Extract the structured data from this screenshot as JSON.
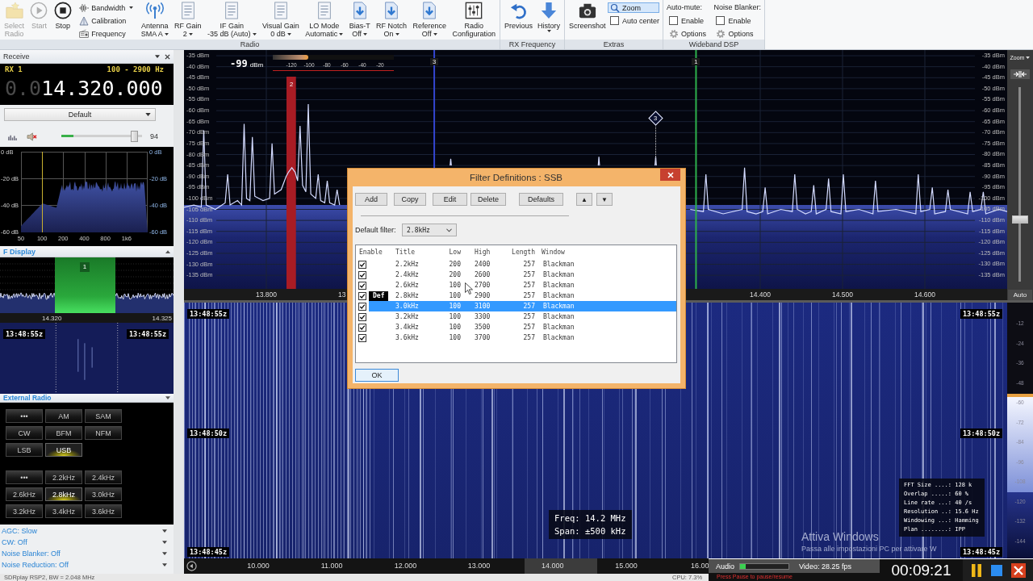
{
  "ribbon": {
    "groups": [
      {
        "label": "Radio",
        "items": [
          {
            "kind": "large",
            "lines": [
              "Select",
              "Radio"
            ],
            "dropdown": false,
            "disabled": true
          },
          {
            "kind": "large",
            "lines": [
              "Start"
            ],
            "dropdown": false,
            "disabled": true
          },
          {
            "kind": "large",
            "lines": [
              "Stop"
            ],
            "dropdown": false,
            "disabled": false
          },
          {
            "kind": "stack",
            "items": [
              {
                "kind": "tool",
                "label": "Bandwidth",
                "dropdown": true
              },
              {
                "kind": "tool",
                "label": "Calibration",
                "dropdown": false
              },
              {
                "kind": "tool",
                "label": "Frequency",
                "dropdown": false
              }
            ]
          },
          {
            "kind": "large",
            "lines": [
              "Antenna",
              "SMA A"
            ],
            "dropdown": true,
            "disabled": false
          },
          {
            "kind": "large",
            "lines": [
              "RF Gain",
              "2"
            ],
            "dropdown": true,
            "disabled": false
          },
          {
            "kind": "large",
            "lines": [
              "IF Gain",
              "-35 dB (Auto)"
            ],
            "dropdown": true,
            "disabled": false
          },
          {
            "kind": "large",
            "lines": [
              "Visual Gain",
              "0 dB"
            ],
            "dropdown": true,
            "disabled": false
          },
          {
            "kind": "large",
            "lines": [
              "LO Mode",
              "Automatic"
            ],
            "dropdown": true,
            "disabled": false
          },
          {
            "kind": "large",
            "lines": [
              "Bias-T",
              "Off"
            ],
            "dropdown": true,
            "disabled": false
          },
          {
            "kind": "large",
            "lines": [
              "RF Notch",
              "On"
            ],
            "dropdown": true,
            "disabled": false
          },
          {
            "kind": "large",
            "lines": [
              "Reference",
              "Off"
            ],
            "dropdown": true,
            "disabled": false
          },
          {
            "kind": "large",
            "lines": [
              "Radio",
              "Configuration"
            ],
            "dropdown": false,
            "disabled": false
          }
        ]
      },
      {
        "label": "RX Frequency",
        "items": [
          {
            "kind": "large",
            "lines": [
              "Previous"
            ],
            "dropdown": false,
            "disabled": false
          },
          {
            "kind": "large",
            "lines": [
              "History"
            ],
            "dropdown": true,
            "disabled": false
          }
        ]
      },
      {
        "label": "Extras",
        "items": [
          {
            "kind": "large",
            "lines": [
              "Screenshot"
            ],
            "dropdown": false,
            "disabled": false
          },
          {
            "kind": "stack",
            "items": [
              {
                "kind": "toggle",
                "label": "Zoom",
                "selected": true
              },
              {
                "kind": "check",
                "label": "Auto center",
                "checked": false
              }
            ]
          }
        ]
      },
      {
        "label": "Wideband DSP",
        "items": [
          {
            "kind": "stack",
            "items": [
              {
                "kind": "heading",
                "label": "Auto-mute:"
              },
              {
                "kind": "check",
                "label": "Enable",
                "checked": false
              },
              {
                "kind": "option",
                "label": "Options"
              }
            ]
          },
          {
            "kind": "stack",
            "items": [
              {
                "kind": "heading",
                "label": "Noise Blanker:"
              },
              {
                "kind": "check",
                "label": "Enable",
                "checked": false
              },
              {
                "kind": "option",
                "label": "Options"
              }
            ]
          }
        ]
      }
    ]
  },
  "receive": {
    "title": "Receive",
    "rx": "RX 1",
    "passband": "100 - 2900 Hz",
    "frequency_prefix": "0.0",
    "frequency": "14.320.000",
    "preset": "Default",
    "audio_meter": {
      "level": 0.15
    },
    "volume": {
      "level": 0.94,
      "reading": "94"
    }
  },
  "audio_spectrum": {
    "y_labels": [
      "0 dB",
      "-20 dB",
      "-40 dB",
      "-60 dB"
    ],
    "right_labels": [
      "0 dB",
      "-20 dB",
      "-40 dB",
      "-60 dB"
    ],
    "x_labels": [
      "50",
      "100",
      "200",
      "400",
      "800",
      "1k6"
    ]
  },
  "if_display": {
    "title": "F Display",
    "filter_label": "1",
    "freq_labels": [
      "14.320",
      "14.325"
    ],
    "times": [
      "13:48:55z",
      "13:48:55z"
    ]
  },
  "external_radio": {
    "title": "External Radio",
    "modes": [
      {
        "label": "•••",
        "selected": false
      },
      {
        "label": "AM",
        "selected": false
      },
      {
        "label": "SAM",
        "selected": false
      },
      {
        "label": "CW",
        "selected": false
      },
      {
        "label": "BFM",
        "selected": false
      },
      {
        "label": "NFM",
        "selected": false
      },
      {
        "label": "LSB",
        "selected": false
      },
      {
        "label": "USB",
        "selected": true
      }
    ],
    "filters": [
      {
        "label": "•••",
        "selected": false
      },
      {
        "label": "2.2kHz",
        "selected": false
      },
      {
        "label": "2.4kHz",
        "selected": false
      },
      {
        "label": "2.6kHz",
        "selected": false
      },
      {
        "label": "2.8kHz",
        "selected": true
      },
      {
        "label": "3.0kHz",
        "selected": false
      },
      {
        "label": "3.2kHz",
        "selected": false
      },
      {
        "label": "3.4kHz",
        "selected": false
      },
      {
        "label": "3.6kHz",
        "selected": false
      }
    ]
  },
  "dsp_sections": [
    "AGC: Slow",
    "CW: Off",
    "Noise Blanker: Off",
    "Noise Reduction: Off"
  ],
  "status_bar": {
    "device": "SDRplay RSP2, BW = 2.048 MHz",
    "cpu": "CPU: 7.3%"
  },
  "spectrum": {
    "signal": "-99",
    "signal_unit": "dBm",
    "signal_meter": {
      "level": 0.29
    },
    "meter_labels": [
      "-120",
      "-100",
      "-80",
      "-60",
      "-40",
      "-20"
    ],
    "chart_data": {
      "type": "line",
      "x": [
        13.7,
        13.712,
        13.721,
        13.724,
        13.727,
        13.738,
        13.75,
        13.753,
        13.756,
        13.765,
        13.77,
        13.773,
        13.776,
        13.78,
        13.783,
        13.786,
        13.796,
        13.804,
        13.807,
        13.81,
        13.818,
        13.824,
        13.827,
        13.831,
        13.835,
        13.838,
        13.841,
        13.844,
        13.848,
        13.851,
        13.854,
        13.86,
        13.863,
        13.866,
        13.871,
        13.874,
        13.877,
        13.883,
        13.886,
        13.889,
        13.905,
        13.925,
        13.945,
        13.965,
        13.985,
        14.005,
        14.0232,
        14.024,
        14.0248,
        14.045,
        14.065,
        14.085,
        14.105,
        14.125,
        14.145,
        14.165,
        14.185,
        14.2032,
        14.204,
        14.2048,
        14.225,
        14.245,
        14.2722,
        14.273,
        14.2738,
        14.295,
        14.315,
        14.331,
        14.334,
        14.337,
        14.355,
        14.378,
        14.381,
        14.384,
        14.395,
        14.403,
        14.406,
        14.409,
        14.425,
        14.439,
        14.442,
        14.445,
        14.455,
        14.462,
        14.465,
        14.468,
        14.48,
        14.483,
        14.486,
        14.498,
        14.501,
        14.504,
        14.52,
        14.537,
        14.54,
        14.543,
        14.565,
        14.589,
        14.592,
        14.595,
        14.606,
        14.609,
        14.612,
        14.625,
        14.628,
        14.631,
        14.652,
        14.655,
        14.658,
        14.668,
        14.671,
        14.674,
        14.69,
        14.7
      ],
      "values": [
        -104,
        -103,
        -104,
        -69,
        -103,
        -105,
        -102,
        -89,
        -103,
        -101,
        -103,
        -66,
        -100,
        -101,
        -72,
        -99,
        -101,
        -100,
        -75,
        -98,
        -96,
        -90,
        -88,
        -86,
        -88,
        -92,
        -67,
        -94,
        -97,
        -57,
        -98,
        -100,
        -89,
        -101,
        -102,
        -92,
        -102,
        -103,
        -96,
        -103,
        null,
        null,
        null,
        null,
        null,
        null,
        -85,
        -82,
        -85,
        null,
        null,
        null,
        null,
        null,
        null,
        null,
        null,
        -85,
        -81,
        -85,
        null,
        null,
        -85,
        -81,
        -85,
        null,
        -105,
        -106,
        -89,
        -105,
        -107,
        -105,
        -86,
        -106,
        -107,
        -106,
        -95,
        -107,
        -105,
        -106,
        -89,
        -105,
        -107,
        -106,
        -94,
        -107,
        -105,
        -91,
        -106,
        -107,
        -89,
        -106,
        -105,
        -107,
        -92,
        -106,
        -105,
        -107,
        -89,
        -106,
        -105,
        -95,
        -107,
        -106,
        -96,
        -105,
        -107,
        -97,
        -106,
        -105,
        -97,
        -107,
        -105,
        -106
      ],
      "xlim": [
        13.7,
        14.7
      ],
      "ylim": [
        -141.2,
        -32.4
      ],
      "grid": true,
      "xticks": [
        {
          "value": 13.8,
          "label": "13.800"
        },
        {
          "value": 14.4,
          "label": "14.400"
        },
        {
          "value": 14.5,
          "label": "14.500"
        },
        {
          "value": 14.6,
          "label": "14.600"
        }
      ],
      "yticks": [
        {
          "value": -35,
          "label": "-35 dBm"
        },
        {
          "value": -40,
          "label": "-40 dBm"
        },
        {
          "value": -45,
          "label": "-45 dBm"
        },
        {
          "value": -50,
          "label": "-50 dBm"
        },
        {
          "value": -55,
          "label": "-55 dBm"
        },
        {
          "value": -60,
          "label": "-60 dBm"
        },
        {
          "value": -65,
          "label": "-65 dBm"
        },
        {
          "value": -70,
          "label": "-70 dBm"
        },
        {
          "value": -75,
          "label": "-75 dBm"
        },
        {
          "value": -80,
          "label": "-80 dBm"
        },
        {
          "value": -85,
          "label": "-85 dBm"
        },
        {
          "value": -90,
          "label": "-90 dBm"
        },
        {
          "value": -95,
          "label": "-95 dBm"
        },
        {
          "value": -100,
          "label": "-100 dBm"
        },
        {
          "value": -105,
          "label": "-105 dBm"
        },
        {
          "value": -110,
          "label": "-110 dBm"
        },
        {
          "value": -115,
          "label": "-115 dBm"
        },
        {
          "value": -120,
          "label": "-120 dBm"
        },
        {
          "value": -125,
          "label": "-125 dBm"
        },
        {
          "value": -130,
          "label": "-130 dBm"
        },
        {
          "value": -135,
          "label": "-135 dBm"
        }
      ],
      "bands": [
        {
          "axis": "x",
          "from": 13.8245,
          "to": 13.836,
          "color": "#a81c24"
        }
      ],
      "ref_lines": [
        {
          "axis": "x",
          "value": 14.004,
          "color": "#3346d0"
        },
        {
          "axis": "x",
          "value": 14.322,
          "color": "#2eb04c"
        }
      ]
    },
    "vfo_labels": [
      "2",
      "3",
      "1"
    ],
    "partial_freq_label": "13",
    "db_labels_right": [
      "-35 dBm",
      "-40 dBm",
      "-45 dBm",
      "-50 dBm",
      "-55 dBm",
      "-60 dBm",
      "-65 dBm",
      "-70 dBm",
      "-75 dBm",
      "-80 dBm",
      "-85 dBm",
      "-90 dBm",
      "-95 dBm",
      "-100 dBm",
      "-105 dBm",
      "-110 dBm",
      "-115 dBm",
      "-120 dBm",
      "-125 dBm",
      "-130 dBm",
      "-135 dBm"
    ],
    "marker": "3"
  },
  "waterfall": {
    "times": [
      {
        "left": "13:48:55z",
        "right": "13:48:55z"
      },
      {
        "left": "13:48:50z",
        "right": "13:48:50z"
      },
      {
        "left": "13:48:45z",
        "right": "13:48:45z"
      }
    ],
    "readout": [
      "Freq: 14.2 MHz",
      "Span: ±500 kHz"
    ],
    "fft_info": [
      "FFT Size ....: 128 k",
      "Overlap .....: 60 %",
      "Line rate ...: 40 /s",
      "Resolution ..: 15.6 Hz",
      "Windowing ...: Hamming",
      "Plan ........: IPP"
    ]
  },
  "side_controls": {
    "zoom": "Zoom",
    "zoom_slider": {
      "level": 0.31
    },
    "auto": "Auto",
    "scale_labels": [
      "-12",
      "-24",
      "-36",
      "-48",
      "-60",
      "-72",
      "-84",
      "-96",
      "-108",
      "-120",
      "-132",
      "-144"
    ]
  },
  "frequency_axis": {
    "labels": [
      "10.000",
      "11.000",
      "12.000",
      "13.000",
      "14.000",
      "15.000",
      "16.00"
    ]
  },
  "filter_dialog": {
    "title": "Filter Definitions : SSB",
    "buttons": [
      "Add",
      "Copy",
      "Edit",
      "Delete",
      "Defaults"
    ],
    "move_buttons": [
      "▲",
      "▼"
    ],
    "default_label": "Default filter:",
    "default_value": "2.8kHz",
    "columns": [
      "Enable",
      "Title",
      "Low",
      "High",
      "Length",
      "Window"
    ],
    "rows": [
      {
        "enabled": true,
        "selected": false,
        "title": "2.2kHz",
        "low": "200",
        "high": "2400",
        "length": "257",
        "window": "Blackman"
      },
      {
        "enabled": true,
        "selected": false,
        "title": "2.4kHz",
        "low": "200",
        "high": "2600",
        "length": "257",
        "window": "Blackman"
      },
      {
        "enabled": true,
        "selected": false,
        "title": "2.6kHz",
        "low": "100",
        "high": "2700",
        "length": "257",
        "window": "Blackman"
      },
      {
        "enabled": true,
        "selected": false,
        "badge": "Def",
        "title": "2.8kHz",
        "low": "100",
        "high": "2900",
        "length": "257",
        "window": "Blackman"
      },
      {
        "enabled": true,
        "selected": true,
        "title": "3.0kHz",
        "low": "100",
        "high": "3100",
        "length": "257",
        "window": "Blackman"
      },
      {
        "enabled": true,
        "selected": false,
        "title": "3.2kHz",
        "low": "100",
        "high": "3300",
        "length": "257",
        "window": "Blackman"
      },
      {
        "enabled": true,
        "selected": false,
        "title": "3.4kHz",
        "low": "100",
        "high": "3500",
        "length": "257",
        "window": "Blackman"
      },
      {
        "enabled": true,
        "selected": false,
        "title": "3.6kHz",
        "low": "100",
        "high": "3700",
        "length": "257",
        "window": "Blackman"
      }
    ],
    "ok": {
      "label": "OK",
      "focused": true
    }
  },
  "recorder": {
    "audio_label": "Audio",
    "audio_meter": {
      "level": 0.12
    },
    "video": "Video: 28.25 fps",
    "timer": "00:09:21",
    "hint": "Press Pause to pause/resume"
  },
  "windows_notice": [
    "Attiva Windows",
    "Passa alle impostazioni PC per attivare W"
  ]
}
